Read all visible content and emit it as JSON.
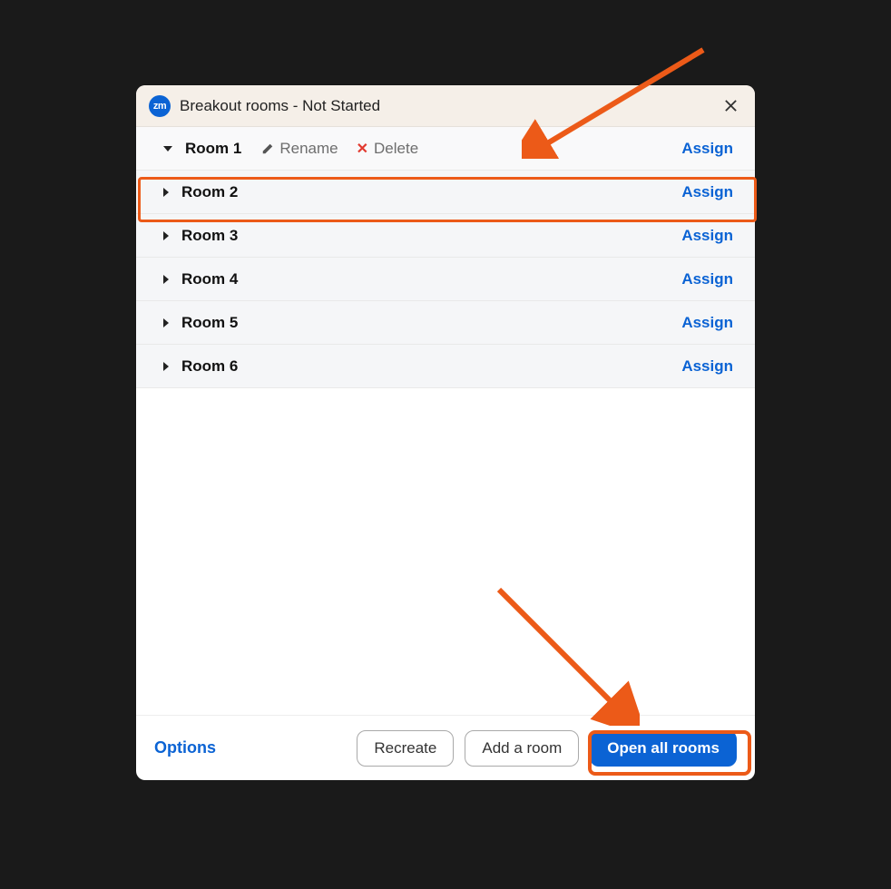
{
  "titlebar": {
    "badge_text": "zm",
    "title": "Breakout rooms - Not Started"
  },
  "rooms": [
    {
      "name": "Room 1",
      "expanded": true,
      "show_actions": true,
      "rename_label": "Rename",
      "delete_label": "Delete",
      "assign_label": "Assign"
    },
    {
      "name": "Room 2",
      "expanded": false,
      "show_actions": false,
      "assign_label": "Assign"
    },
    {
      "name": "Room 3",
      "expanded": false,
      "show_actions": false,
      "assign_label": "Assign"
    },
    {
      "name": "Room 4",
      "expanded": false,
      "show_actions": false,
      "assign_label": "Assign"
    },
    {
      "name": "Room 5",
      "expanded": false,
      "show_actions": false,
      "assign_label": "Assign"
    },
    {
      "name": "Room 6",
      "expanded": false,
      "show_actions": false,
      "assign_label": "Assign"
    }
  ],
  "footer": {
    "options_label": "Options",
    "recreate_label": "Recreate",
    "add_room_label": "Add a room",
    "open_all_label": "Open all rooms"
  },
  "colors": {
    "accent": "#0b63d4",
    "highlight": "#ec5a18",
    "danger": "#e23a2f"
  }
}
